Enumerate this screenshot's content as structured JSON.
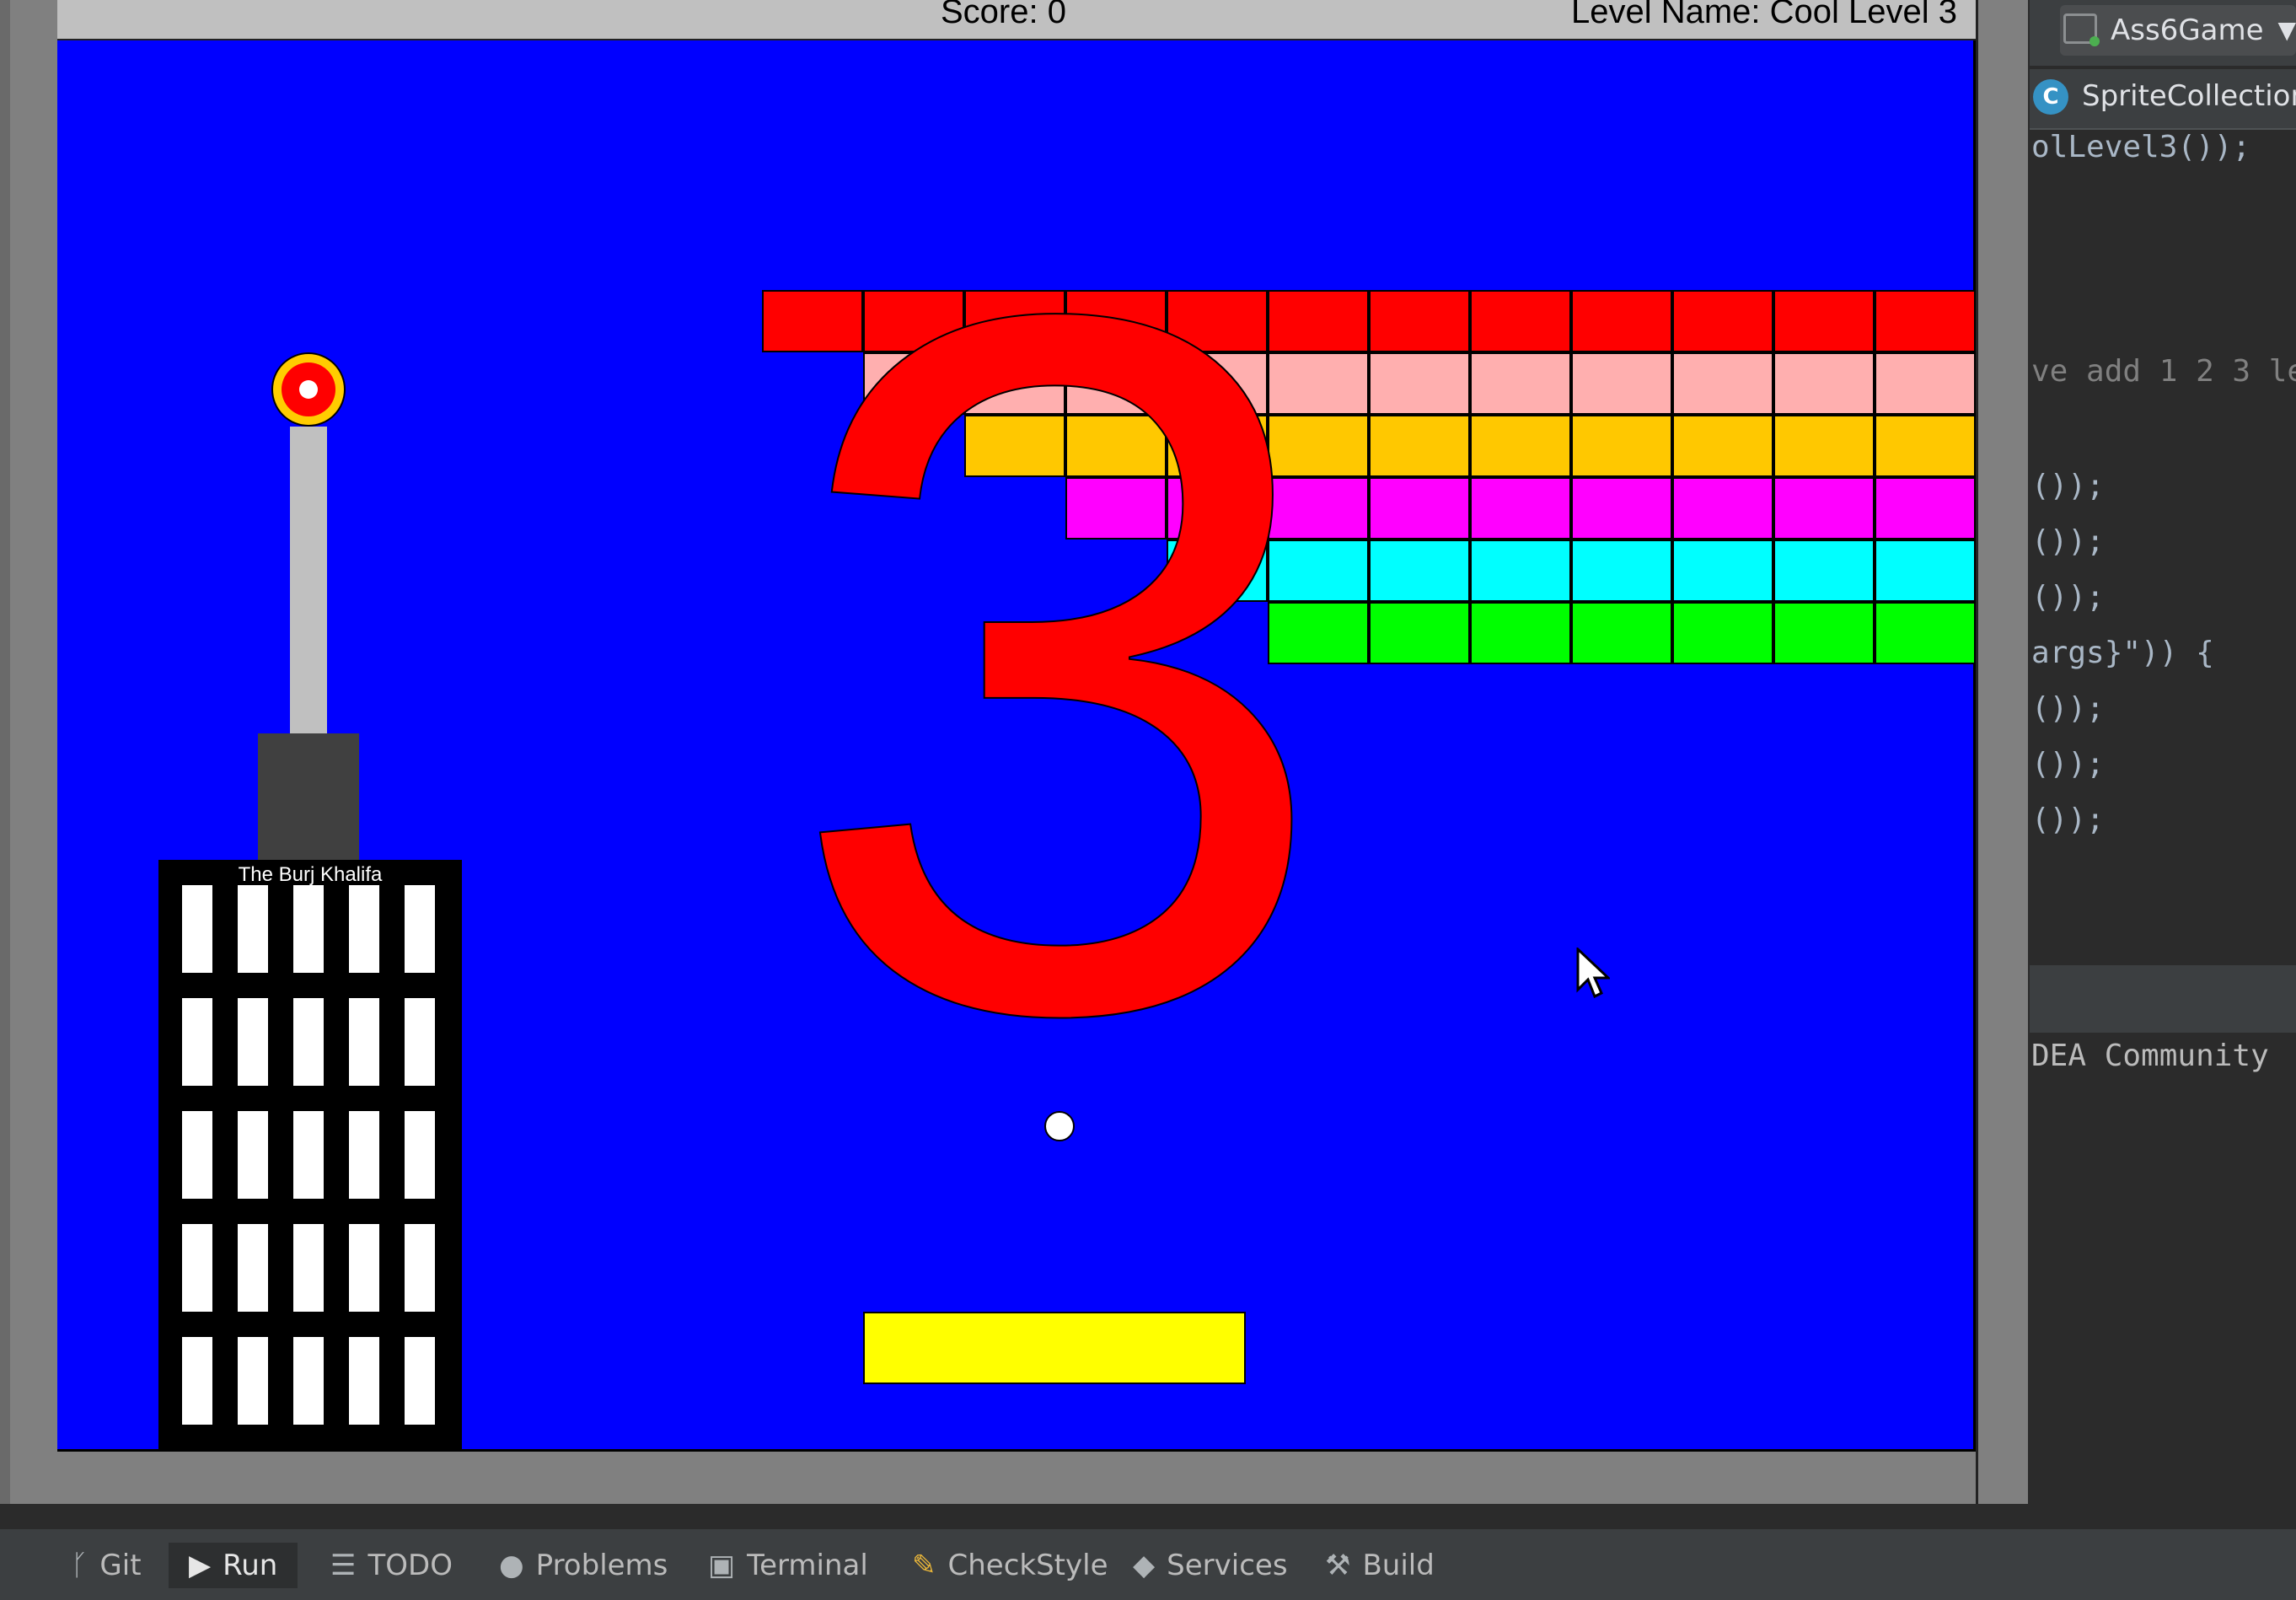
{
  "hud": {
    "score_label": "Score: 0",
    "level_label": "Level Name: Cool Level 3"
  },
  "level_number_graphic": "3",
  "tower": {
    "label": "The Burj Khalifa"
  },
  "colors": {
    "background": "#0000ff",
    "row1": "#ff0000",
    "row2": "#ffafaf",
    "row3": "#ffc800",
    "row4": "#ff00ff",
    "row5": "#00ffff",
    "row6": "#00ff00",
    "paddle": "#ffff00",
    "ball": "#ffffff"
  },
  "blocks": {
    "row1_count": 12,
    "row2_count": 11,
    "row3_count": 10,
    "row4_count": 9,
    "row5_count": 8,
    "row6_count": 7
  },
  "ide": {
    "project_selector": "Ass6Game",
    "editor_tab": "SpriteCollection",
    "code_lines": [
      {
        "text": "olLevel3());"
      },
      {
        "text": "ve add 1 2 3 le"
      },
      {
        "text": "());"
      },
      {
        "text": "());"
      },
      {
        "text": "());"
      },
      {
        "text": "args}\")) {"
      },
      {
        "text": "());"
      },
      {
        "text": "());"
      },
      {
        "text": "());"
      }
    ],
    "console_text": "DEA Community",
    "bottom_tools": [
      {
        "label": "Git",
        "icon": "git-branch-icon"
      },
      {
        "label": "Run",
        "icon": "run-icon"
      },
      {
        "label": "TODO",
        "icon": "list-icon"
      },
      {
        "label": "Problems",
        "icon": "warning-icon"
      },
      {
        "label": "Terminal",
        "icon": "terminal-icon"
      },
      {
        "label": "CheckStyle",
        "icon": "pencil-icon"
      },
      {
        "label": "Services",
        "icon": "services-icon"
      },
      {
        "label": "Build",
        "icon": "hammer-icon"
      }
    ]
  }
}
